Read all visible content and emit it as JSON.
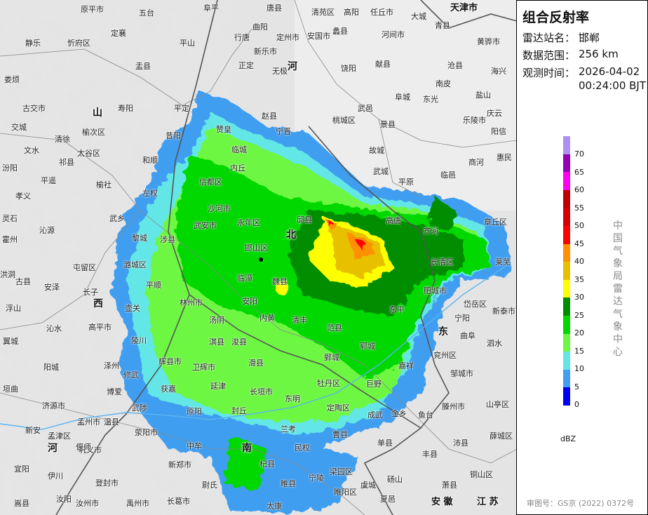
{
  "panel": {
    "title": "组合反射率",
    "station_label": "雷达站名：",
    "station": "邯郸",
    "range_label": "数据范围：",
    "range": "256 km",
    "time_label": "观测时间：",
    "date": "2026-04-02",
    "time": "00:24:00 BJT",
    "legend_unit": "dBZ",
    "legend": [
      {
        "value": "70",
        "color": "#ad91f0"
      },
      {
        "value": "65",
        "color": "#9600b4"
      },
      {
        "value": "60",
        "color": "#ff00f0"
      },
      {
        "value": "55",
        "color": "#c00000"
      },
      {
        "value": "50",
        "color": "#d60000"
      },
      {
        "value": "45",
        "color": "#ff0000"
      },
      {
        "value": "40",
        "color": "#ff9000"
      },
      {
        "value": "35",
        "color": "#e7c000"
      },
      {
        "value": "30",
        "color": "#ffff00"
      },
      {
        "value": "25",
        "color": "#008e00"
      },
      {
        "value": "20",
        "color": "#00d800"
      },
      {
        "value": "15",
        "color": "#6ef742"
      },
      {
        "value": "10",
        "color": "#63e6e6"
      },
      {
        "value": "5",
        "color": "#419ef0"
      },
      {
        "value": "0",
        "color": "#0000f6"
      }
    ],
    "credit": "中国气象局雷达气象中心",
    "map_approval": "审图号：GS京 (2022) 0372号"
  },
  "map": {
    "provinces": [
      "山",
      "西",
      "河",
      "北",
      "东",
      "河",
      "南",
      "安 徽",
      "江 苏",
      "天津市"
    ],
    "places": [
      "原平市",
      "五台",
      "阜平",
      "唐县",
      "清苑区",
      "高阳",
      "任丘市",
      "大城",
      "青县",
      "黄骅市",
      "静乐",
      "忻府区",
      "定襄",
      "平山",
      "行唐",
      "曲阳",
      "定州市",
      "安国市",
      "蠡县",
      "河间市",
      "盂县",
      "新乐市",
      "正定",
      "无极",
      "饶阳",
      "献县",
      "沧县",
      "海兴",
      "娄烦",
      "古交市",
      "寿阳",
      "平定",
      "赵县",
      "桃城区",
      "武邑",
      "景县",
      "阜城",
      "东光",
      "南皮",
      "盐山",
      "庆云",
      "交城",
      "清徐",
      "榆次区",
      "昔阳",
      "赞皇",
      "宁晋",
      "故城",
      "乐陵市",
      "阳信",
      "文水",
      "太谷区",
      "和顺",
      "临城",
      "武城",
      "平原",
      "临邑",
      "商河",
      "惠民",
      "汾阳",
      "祁县",
      "平遥",
      "榆社",
      "内丘",
      "信都区",
      "左权",
      "孝义",
      "灵石",
      "沁源",
      "武乡",
      "沙河市",
      "永年区",
      "邱县",
      "高唐",
      "齐河",
      "章丘区",
      "霍州",
      "黎城",
      "武安市",
      "涉县",
      "邯山区",
      "魏县",
      "长清区",
      "莱芜",
      "古县",
      "屯留区",
      "潞城区",
      "平顺",
      "临漳",
      "洪洞",
      "安泽",
      "长子",
      "壶关",
      "林州市",
      "安阳",
      "内黄",
      "清丰",
      "范县",
      "东平",
      "肥城市",
      "岱岳区",
      "新泰市",
      "浮山",
      "沁水",
      "高平市",
      "陵川",
      "淇县",
      "浚县",
      "汤阴",
      "宁阳",
      "曲阜",
      "泗水",
      "翼城",
      "阳城",
      "泽州",
      "辉县市",
      "卫辉市",
      "滑县",
      "郓城",
      "鄄城",
      "兖州区",
      "垣曲",
      "济源市",
      "博爱",
      "修武",
      "获嘉",
      "延津",
      "长垣市",
      "牡丹区",
      "巨野",
      "嘉祥",
      "邹城市",
      "东明",
      "定陶区",
      "成武",
      "金乡",
      "鱼台",
      "滕州市",
      "山亭区",
      "孟津区",
      "孟州市",
      "温县",
      "武陟",
      "原阳",
      "封丘",
      "曹县",
      "单县",
      "丰县",
      "沛县",
      "薛城区",
      "新安",
      "巩义市",
      "荥阳市",
      "中牟",
      "兰考",
      "民权",
      "宜阳",
      "偃师",
      "新郑市",
      "杞县",
      "宁陵",
      "梁园区",
      "虞城",
      "砀山",
      "萧县",
      "铜山区",
      "伊川",
      "登封市",
      "尉氏",
      "睢县",
      "嵩县",
      "汝阳",
      "汝州市",
      "禹州市",
      "长葛市",
      "太康",
      "夏邑",
      "睢阳区"
    ]
  }
}
